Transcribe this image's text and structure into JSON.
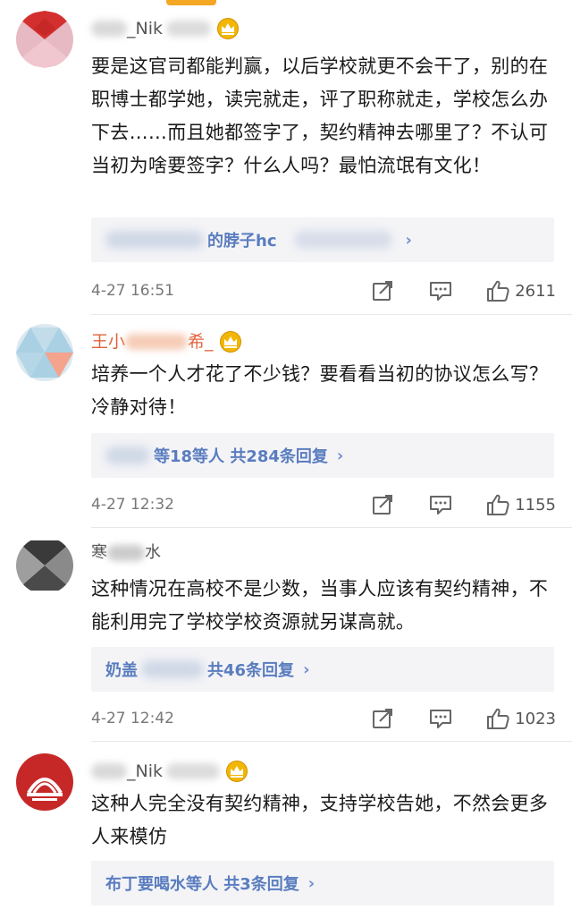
{
  "comments": [
    {
      "username": "_Nik",
      "text": "要是这官司都能判赢，以后学校就更不会干了，别的在职博士都学她，读完就走，评了职称就走，学校怎么办下去……而且她都签字了，契约精神去哪里了？不认可当初为啥要签字？什么人吗？最怕流氓有文化！",
      "reply_preview": "的脖子hc",
      "time": "4-27 16:51",
      "likes": "2611",
      "avatar_colors": [
        "#d32f2f",
        "#f3c4cc",
        "#ffffff"
      ]
    },
    {
      "username": "王小",
      "username_suffix": "希_",
      "text": "培养一个人才花了不少钱？要看看当初的协议怎么写？冷静对待！",
      "reply_preview": "等18等人  共284条回复",
      "time": "4-27 12:32",
      "likes": "1155",
      "avatar_colors": [
        "#a9d0e3",
        "#f4a38d",
        "#dde9f1"
      ]
    },
    {
      "username": "寒",
      "username_suffix": "水",
      "text": "这种情况在高校不是少数，当事人应该有契约精神，不能利用完了学校学校资源就另谋高就。",
      "reply_preview": "共46条回复",
      "reply_prefix": "奶盖",
      "time": "4-27 12:42",
      "likes": "1023",
      "avatar_colors": [
        "#3a3a3a",
        "#9e9e9e",
        "#ffffff"
      ]
    },
    {
      "username": "_Nik",
      "text": "这种人完全没有契约精神，支持学校告她，不然会更多人来模仿",
      "reply_preview": "布丁要喝水等人  共3条回复",
      "time": "",
      "likes": "",
      "avatar_colors": [
        "#c62828",
        "#ffffff",
        "#9b1c1c"
      ]
    }
  ],
  "colors": {
    "link": "#5a7dbf",
    "reply_bg": "#f4f4f7",
    "crown": "#f2b705"
  },
  "icons": [
    "share-icon",
    "comment-icon",
    "like-icon",
    "crown-icon",
    "chevron-right-icon"
  ]
}
